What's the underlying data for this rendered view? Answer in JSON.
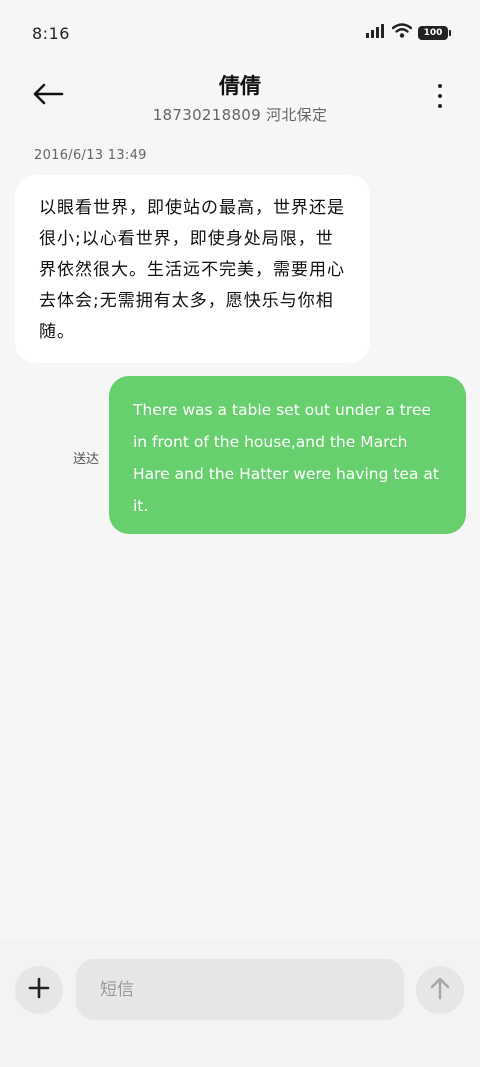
{
  "status_bar": {
    "time": "8:16",
    "battery": "100",
    "icons": [
      "signal-icon",
      "wifi-icon",
      "battery-icon"
    ]
  },
  "header": {
    "contact_name": "倩倩",
    "contact_sub": "18730218809 河北保定",
    "icons": [
      "back-arrow-icon",
      "more-vert-icon"
    ]
  },
  "conversation": {
    "timestamp": "2016/6/13 13:49",
    "incoming_text": "以眼看世界，即使站の最高，世界还是很小;以心看世界，即使身处局限，世界依然很大。生活远不完美，需要用心去体会;无需拥有太多，愿快乐与你相随。",
    "sent_status": "送达",
    "outgoing_text": "There was a table set out under a tree in front of the house,and the March Hare and the Hatter were having tea at it."
  },
  "composer": {
    "placeholder": "短信",
    "value": "",
    "icons": [
      "plus-icon",
      "send-arrow-icon"
    ]
  },
  "colors": {
    "background": "#f6f6f6",
    "incoming_bubble": "#ffffff",
    "outgoing_bubble": "#67cf6e",
    "input_bg": "#e6e6e6"
  }
}
